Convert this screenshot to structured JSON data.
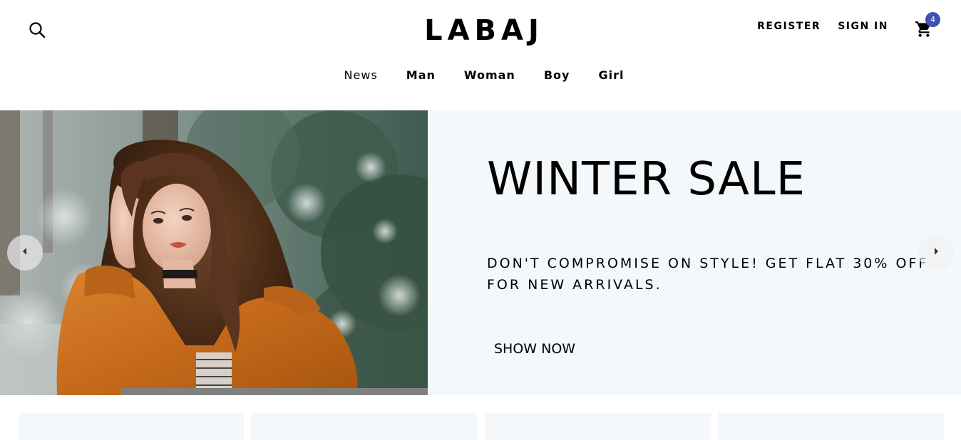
{
  "header": {
    "logo": "LABAJ",
    "register_label": "REGISTER",
    "signin_label": "SIGN IN",
    "cart_count": "4"
  },
  "nav": {
    "items": [
      {
        "label": "News"
      },
      {
        "label": "Man"
      },
      {
        "label": "Woman"
      },
      {
        "label": "Boy"
      },
      {
        "label": "Girl"
      }
    ]
  },
  "slider": {
    "title": "WINTER SALE",
    "description": "DON'T COMPROMISE ON STYLE! GET FLAT 30% OFF FOR NEW ARRIVALS.",
    "button_label": "SHOW NOW",
    "background_color": "#f4f8fb",
    "image": "woman-in-orange-winter-coat-photo"
  },
  "icons": {
    "search": "search-icon",
    "cart": "shopping-cart-icon",
    "prev": "arrow-left-icon",
    "next": "arrow-right-icon"
  },
  "colors": {
    "badge": "#3f51b5",
    "slide_bg": "#f4f8fb"
  }
}
